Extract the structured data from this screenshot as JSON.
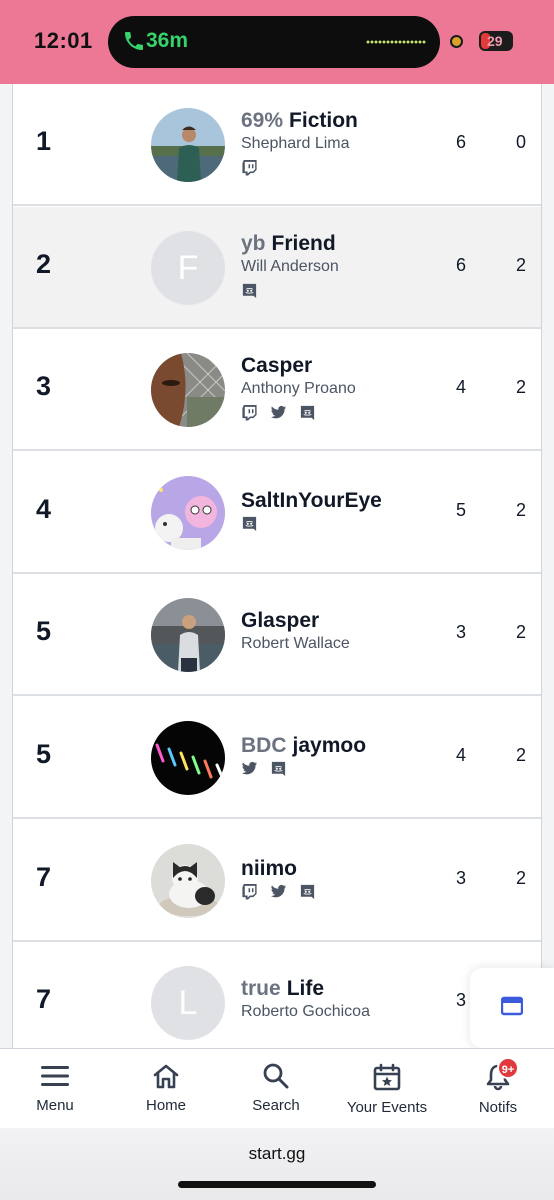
{
  "status_bar": {
    "time": "12:01",
    "call_timer": "36m",
    "battery": "29",
    "accent_color": "#ec7896"
  },
  "standings": [
    {
      "rank": "1",
      "prefix": "69%",
      "tag": "Fiction",
      "real_name": "Shephard Lima",
      "socials": [
        "twitch-icon"
      ],
      "stat_a": "6",
      "stat_b": "0",
      "avatar": "photo-person-lake"
    },
    {
      "rank": "2",
      "prefix": "yb",
      "tag": "Friend",
      "real_name": "Will Anderson",
      "socials": [
        "discord-icon"
      ],
      "stat_a": "6",
      "stat_b": "2",
      "avatar_letter": "F"
    },
    {
      "rank": "3",
      "prefix": "",
      "tag": "Casper",
      "real_name": "Anthony Proano",
      "socials": [
        "twitch-icon",
        "twitter-icon",
        "discord-icon"
      ],
      "stat_a": "4",
      "stat_b": "2",
      "avatar": "photo-face-fence"
    },
    {
      "rank": "4",
      "prefix": "",
      "tag": "SaltInYourEye",
      "real_name": "",
      "socials": [
        "discord-icon"
      ],
      "stat_a": "5",
      "stat_b": "2",
      "avatar": "art-cartoon"
    },
    {
      "rank": "5",
      "prefix": "",
      "tag": "Glasper",
      "real_name": "Robert Wallace",
      "socials": [],
      "stat_a": "3",
      "stat_b": "2",
      "avatar": "photo-person-harbor"
    },
    {
      "rank": "5",
      "prefix": "BDC",
      "tag": "jaymoo",
      "real_name": "",
      "socials": [
        "twitter-icon",
        "discord-icon"
      ],
      "stat_a": "4",
      "stat_b": "2",
      "avatar": "art-neon-lights"
    },
    {
      "rank": "7",
      "prefix": "",
      "tag": "niimo",
      "real_name": "",
      "socials": [
        "twitch-icon",
        "twitter-icon",
        "discord-icon"
      ],
      "stat_a": "3",
      "stat_b": "2",
      "avatar": "photo-cat"
    },
    {
      "rank": "7",
      "prefix": "true",
      "tag": "Life",
      "real_name": "Roberto Gochicoa",
      "socials": [],
      "stat_a": "3",
      "stat_b": "",
      "avatar_letter": "L"
    }
  ],
  "bottom_nav": {
    "items": [
      {
        "label": "Menu",
        "icon": "hamburger-icon"
      },
      {
        "label": "Home",
        "icon": "home-icon"
      },
      {
        "label": "Search",
        "icon": "search-icon"
      },
      {
        "label": "Your Events",
        "icon": "calendar-star-icon"
      },
      {
        "label": "Notifs",
        "icon": "bell-icon"
      }
    ],
    "notif_badge": "9+"
  },
  "browser": {
    "url": "start.gg"
  }
}
